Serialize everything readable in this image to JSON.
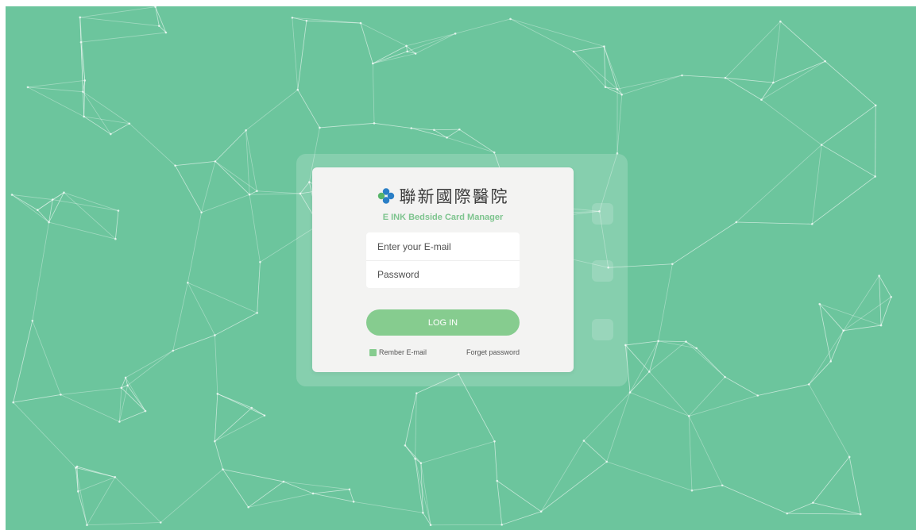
{
  "colors": {
    "background": "#6cc59d",
    "card": "#f3f3f2",
    "accent": "#86cc8f",
    "subtitle": "#7dc48e",
    "logo_blue": "#2a7fc6",
    "logo_green": "#57b56a"
  },
  "brand": {
    "logo_icon": "clover-logo-icon",
    "name": "聯新國際醫院",
    "subtitle": "E INK Bedside Card Manager"
  },
  "form": {
    "email_placeholder": "Enter your E-mail",
    "email_value": "",
    "password_placeholder": "Password",
    "password_value": "",
    "login_label": "LOG IN",
    "remember_label": "Rember E-mail",
    "remember_checked": true,
    "forgot_label": "Forget password"
  }
}
